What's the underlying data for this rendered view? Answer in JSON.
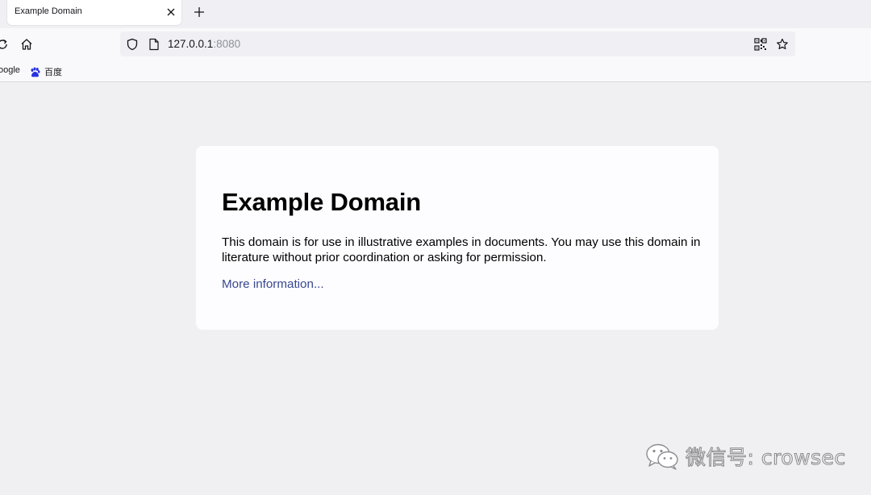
{
  "browser": {
    "tab_title": "Example Domain",
    "url_host": "127.0.0.1",
    "url_port": ":8080"
  },
  "bookmarks": {
    "items": [
      {
        "label": "oogle",
        "icon": "google-icon"
      },
      {
        "label": "百度",
        "icon": "baidu-paw-icon"
      }
    ]
  },
  "page": {
    "heading": "Example Domain",
    "paragraph": "This domain is for use in illustrative examples in documents. You may use this domain in literature without prior coordination or asking for permission.",
    "link_text": "More information...",
    "link_color": "#38488f"
  },
  "watermark": {
    "text": "微信号: crowsec",
    "icon": "wechat-icon"
  },
  "colors": {
    "chrome_bg": "#f0f0f4",
    "toolbar_bg": "#f9f9fb",
    "content_bg": "#f0f0f2",
    "card_bg": "#fdfdff"
  }
}
